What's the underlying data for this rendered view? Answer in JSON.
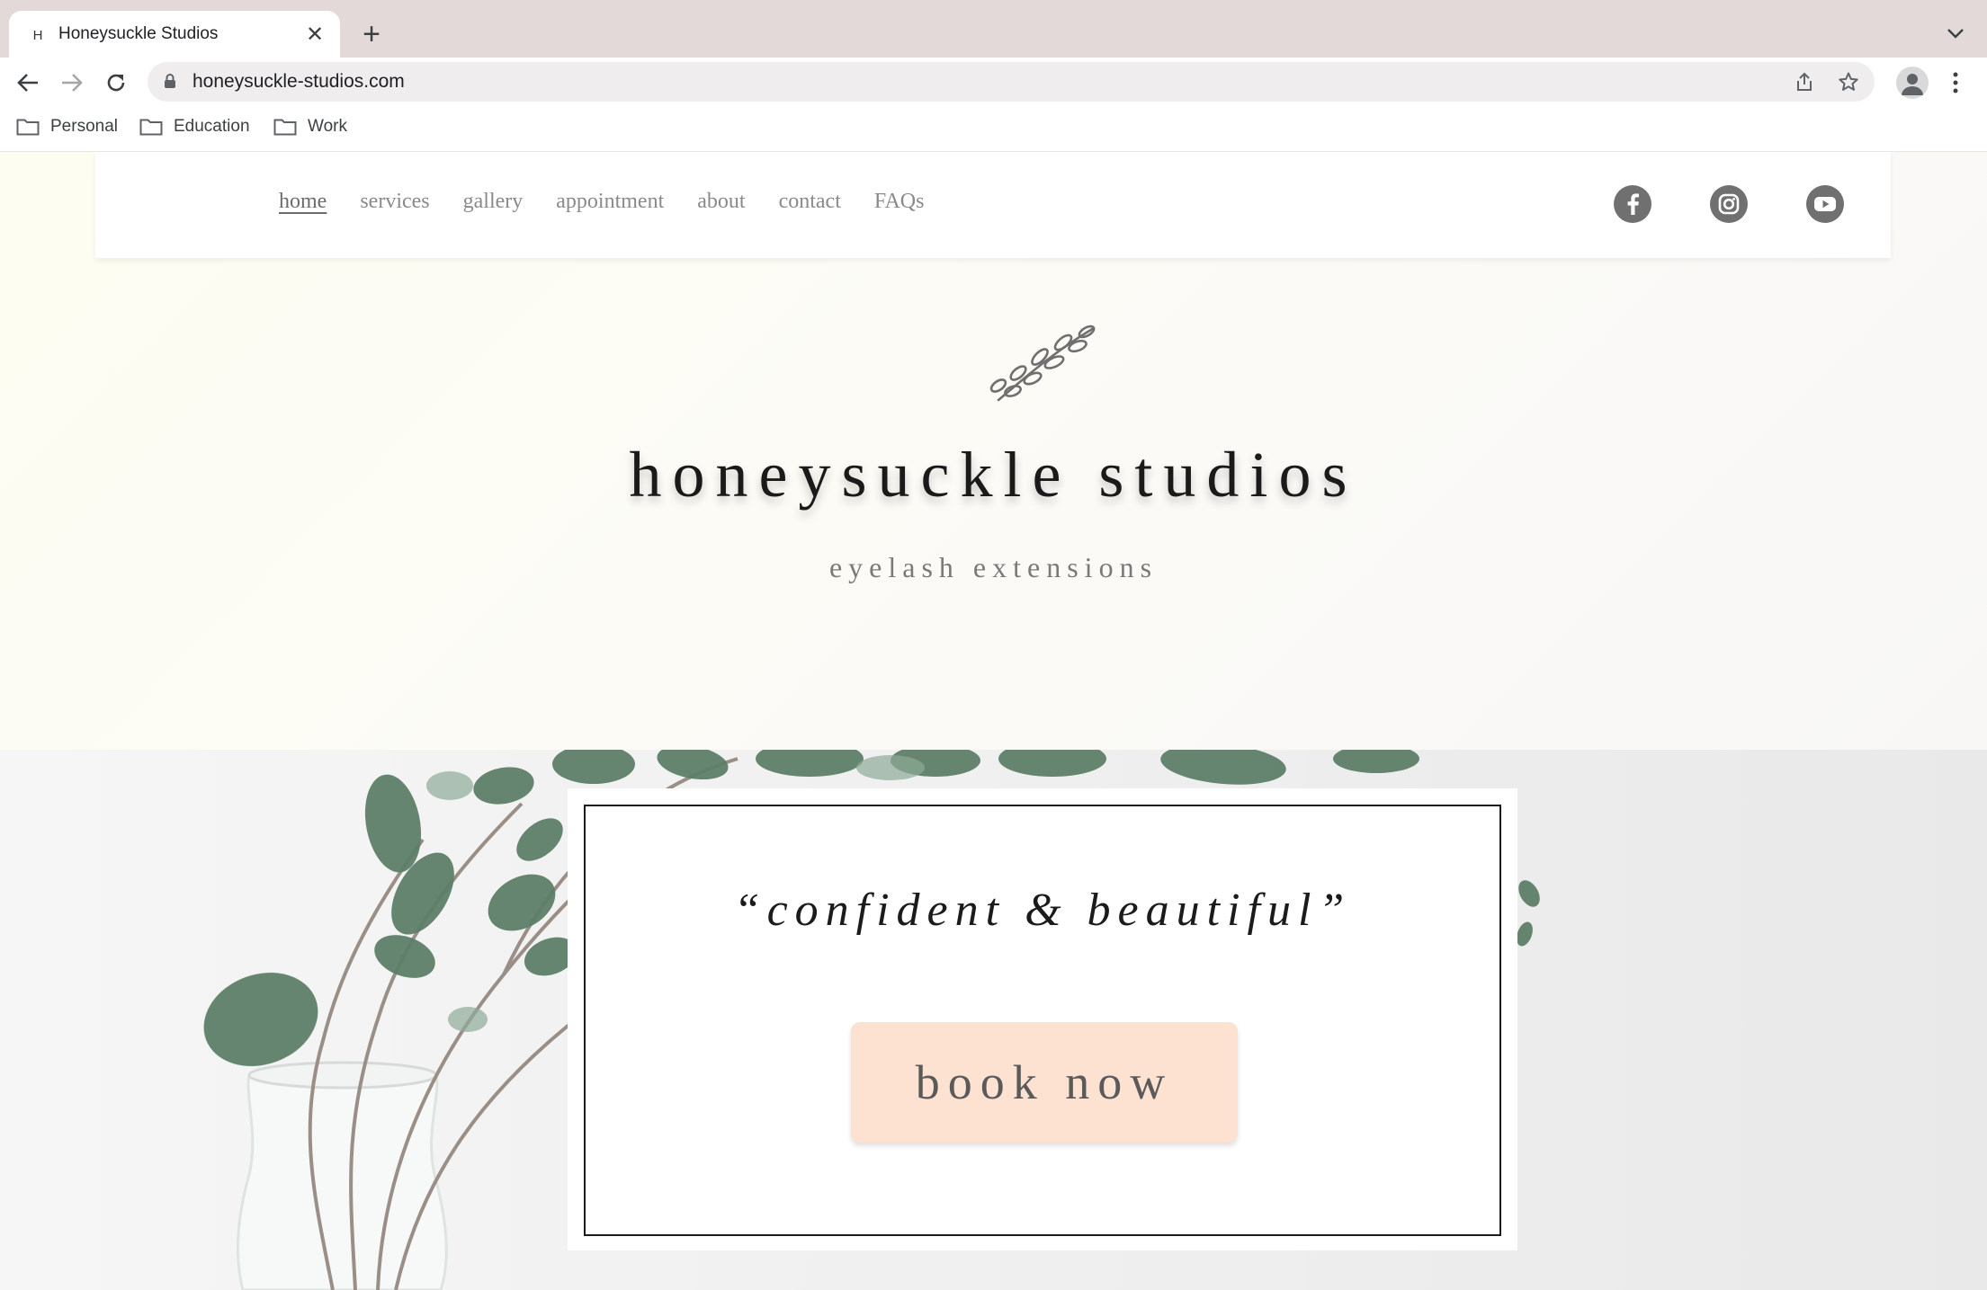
{
  "browser": {
    "tab_favicon": "H",
    "tab_title": "Honeysuckle Studios",
    "url": "honeysuckle-studios.com",
    "bookmarks": [
      "Personal",
      "Education",
      "Work"
    ]
  },
  "site": {
    "nav": [
      "home",
      "services",
      "gallery",
      "appointment",
      "about",
      "contact",
      "FAQs"
    ],
    "active_nav": "home",
    "social": [
      "facebook-icon",
      "instagram-icon",
      "youtube-icon"
    ],
    "brand": "honeysuckle studios",
    "tagline": "eyelash extensions",
    "quote": "“confident & beautiful”",
    "cta": "book now"
  },
  "colors": {
    "cta_background": "#fde2d2",
    "social_icon": "#707070",
    "tab_strip": "#e3d9d9"
  }
}
